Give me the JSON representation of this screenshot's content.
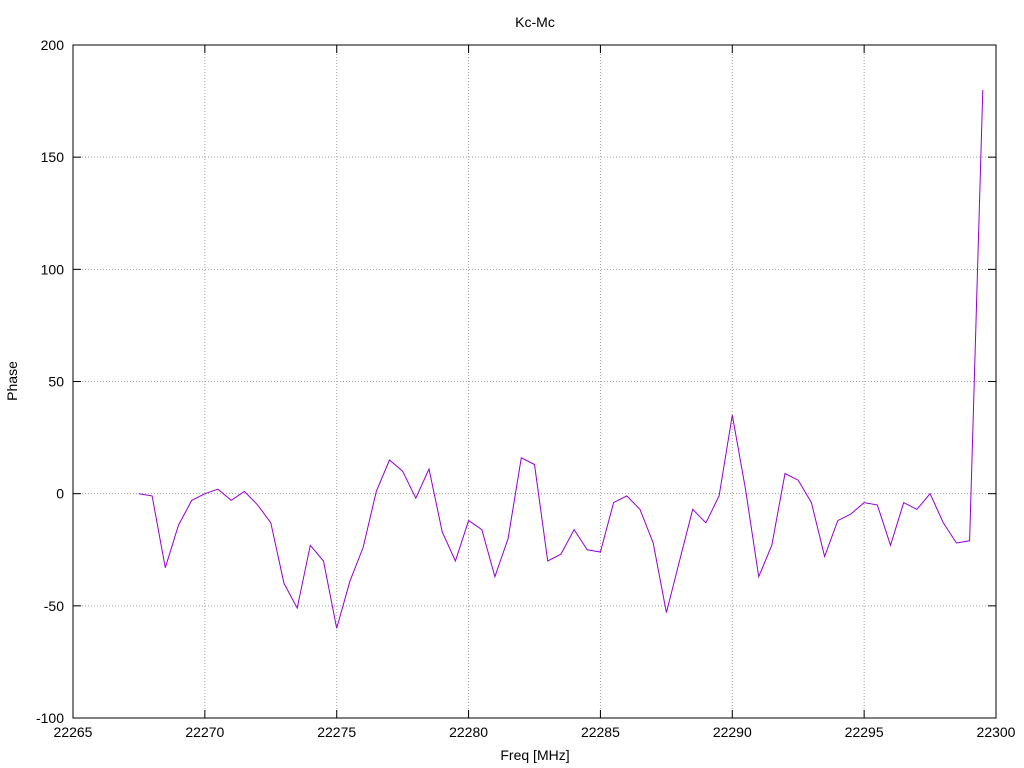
{
  "chart_data": {
    "type": "line",
    "title": "Kc-Mc",
    "xlabel": "Freq [MHz]",
    "ylabel": "Phase",
    "xlim": [
      22265,
      22300
    ],
    "ylim": [
      -100,
      200
    ],
    "xticks": [
      22265,
      22270,
      22275,
      22280,
      22285,
      22290,
      22295,
      22300
    ],
    "yticks": [
      -100,
      -50,
      0,
      50,
      100,
      150,
      200
    ],
    "grid": true,
    "series": [
      {
        "color": "#9400d3",
        "x": [
          22267.5,
          22268.0,
          22268.5,
          22269.0,
          22269.5,
          22270.0,
          22270.5,
          22271.0,
          22271.5,
          22272.0,
          22272.5,
          22273.0,
          22273.5,
          22274.0,
          22274.5,
          22275.0,
          22275.5,
          22276.0,
          22276.5,
          22277.0,
          22277.5,
          22278.0,
          22278.5,
          22279.0,
          22279.5,
          22280.0,
          22280.5,
          22281.0,
          22281.5,
          22282.0,
          22282.5,
          22283.0,
          22283.5,
          22284.0,
          22284.5,
          22285.0,
          22285.5,
          22286.0,
          22286.5,
          22287.0,
          22287.5,
          22288.0,
          22288.5,
          22289.0,
          22289.5,
          22290.0,
          22290.5,
          22291.0,
          22291.5,
          22292.0,
          22292.5,
          22293.0,
          22293.5,
          22294.0,
          22294.5,
          22295.0,
          22295.5,
          22296.0,
          22296.5,
          22297.0,
          22297.5,
          22298.0,
          22298.5,
          22299.0,
          22299.5
        ],
        "y": [
          0,
          -1,
          -33,
          -14,
          -3,
          0,
          2,
          -3,
          1,
          -5,
          -13,
          -40,
          -51,
          -23,
          -30,
          -60,
          -39,
          -24,
          1,
          15,
          10,
          -2,
          11,
          -17,
          -30,
          -12,
          -16,
          -37,
          -20,
          16,
          13,
          -30,
          -27,
          -16,
          -25,
          -26,
          -4,
          -1,
          -7,
          -22,
          -53,
          -30,
          -7,
          -13,
          -1,
          35,
          2,
          -37,
          -23,
          9,
          6,
          -4,
          -28,
          -12,
          -9,
          -4,
          -5,
          -23,
          -4,
          -7,
          0,
          -13,
          -22,
          -21,
          180
        ]
      }
    ]
  }
}
